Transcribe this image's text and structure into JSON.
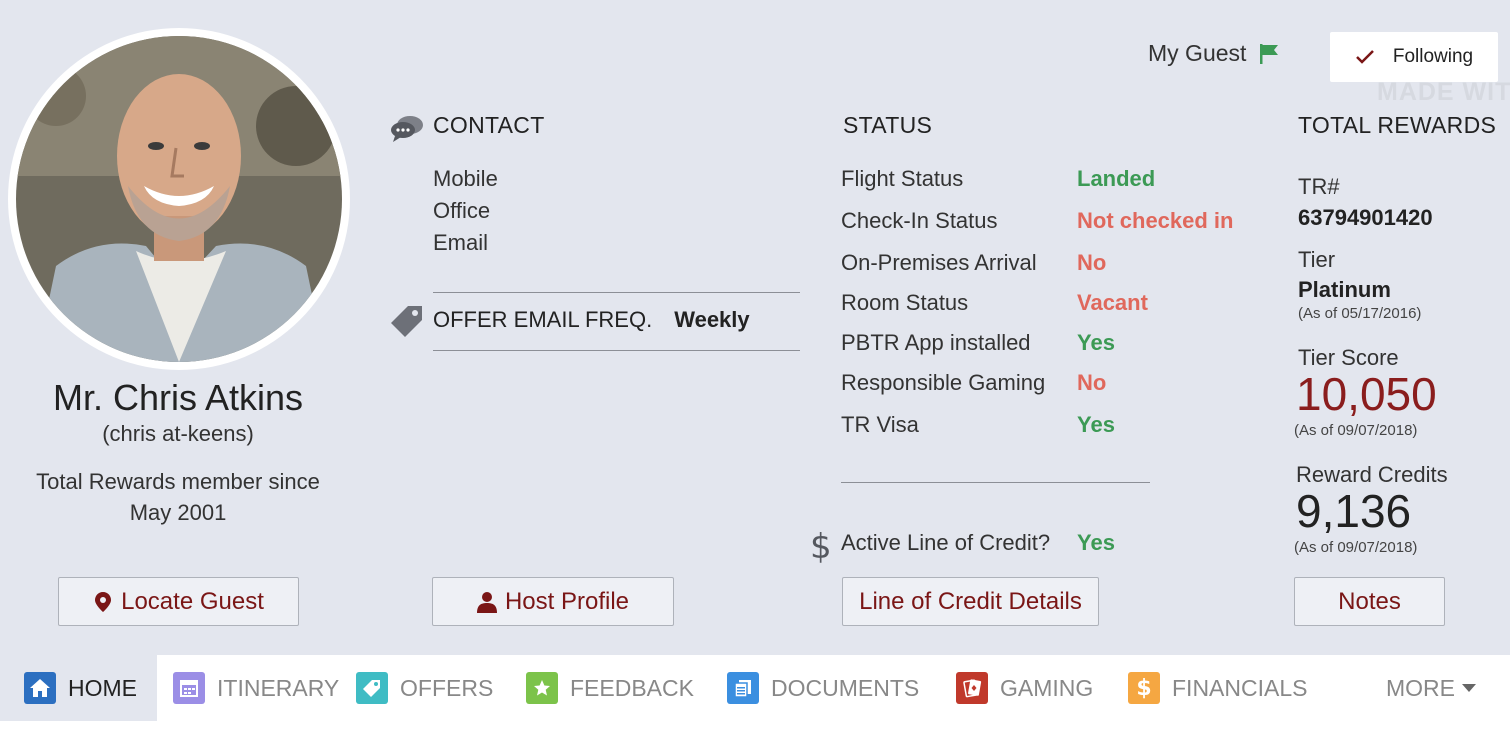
{
  "header": {
    "my_guest_label": "My Guest",
    "following_label": "Following",
    "watermark": "MADE WIT"
  },
  "guest": {
    "name": "Mr. Chris Atkins",
    "pronunciation": "(chris at-keens)",
    "member_since_line1": "Total Rewards member since",
    "member_since_line2": "May 2001"
  },
  "contact": {
    "heading": "CONTACT",
    "lines": [
      "Mobile",
      "Office",
      "Email"
    ],
    "offer_label": "OFFER EMAIL FREQ.",
    "offer_value": "Weekly"
  },
  "status": {
    "heading": "STATUS",
    "rows": [
      {
        "label": "Flight Status",
        "value": "Landed",
        "color": "#3c9a55"
      },
      {
        "label": "Check-In Status",
        "value": "Not checked in",
        "color": "#e0685c"
      },
      {
        "label": "On-Premises Arrival",
        "value": "No",
        "color": "#e0685c"
      },
      {
        "label": "Room Status",
        "value": "Vacant",
        "color": "#e0685c"
      },
      {
        "label": "PBTR App installed",
        "value": "Yes",
        "color": "#3c9a55"
      },
      {
        "label": "Responsible Gaming",
        "value": "No",
        "color": "#e0685c"
      },
      {
        "label": "TR Visa",
        "value": "Yes",
        "color": "#3c9a55"
      }
    ],
    "credit_label": "Active Line of Credit?",
    "credit_value": "Yes"
  },
  "rewards": {
    "heading": "TOTAL REWARDS",
    "tr_label": "TR#",
    "tr_number": "63794901420",
    "tier_label": "Tier",
    "tier_value": "Platinum",
    "tier_asof": "(As of 05/17/2016)",
    "score_label": "Tier Score",
    "score_value": "10,050",
    "score_asof": "(As of 09/07/2018)",
    "credits_label": "Reward Credits",
    "credits_value": "9,136",
    "credits_asof": "(As of 09/07/2018)"
  },
  "buttons": {
    "locate": "Locate Guest",
    "host": "Host Profile",
    "credit": "Line of Credit Details",
    "notes": "Notes"
  },
  "nav": {
    "items": [
      {
        "label": "HOME",
        "color": "#2c6fc0",
        "icon": "home-icon"
      },
      {
        "label": "ITINERARY",
        "color": "#9b8ee6",
        "icon": "calendar-icon"
      },
      {
        "label": "OFFERS",
        "color": "#3fbcc4",
        "icon": "tag-icon"
      },
      {
        "label": "FEEDBACK",
        "color": "#7cc34a",
        "icon": "star-icon"
      },
      {
        "label": "DOCUMENTS",
        "color": "#3b8fe0",
        "icon": "document-icon"
      },
      {
        "label": "GAMING",
        "color": "#c0392b",
        "icon": "cards-icon"
      },
      {
        "label": "FINANCIALS",
        "color": "#f5a742",
        "icon": "dollar-icon"
      }
    ],
    "more": "MORE"
  }
}
